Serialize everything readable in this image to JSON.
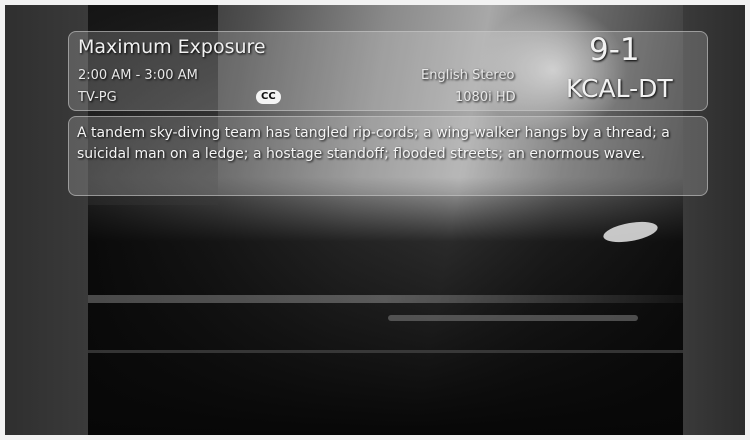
{
  "program": {
    "title": "Maximum Exposure",
    "time": "2:00 AM - 3:00 AM",
    "rating": "TV-PG",
    "cc_badge": "CC",
    "audio": "English Stereo",
    "video": "1080i HD",
    "description": "A tandem sky-diving team has tangled rip-cords; a wing-walker hangs by a thread; a suicidal man on a ledge; a hostage standoff; flooded streets; an enormous wave."
  },
  "channel": {
    "number": "9-1",
    "name": "KCAL-DT"
  }
}
